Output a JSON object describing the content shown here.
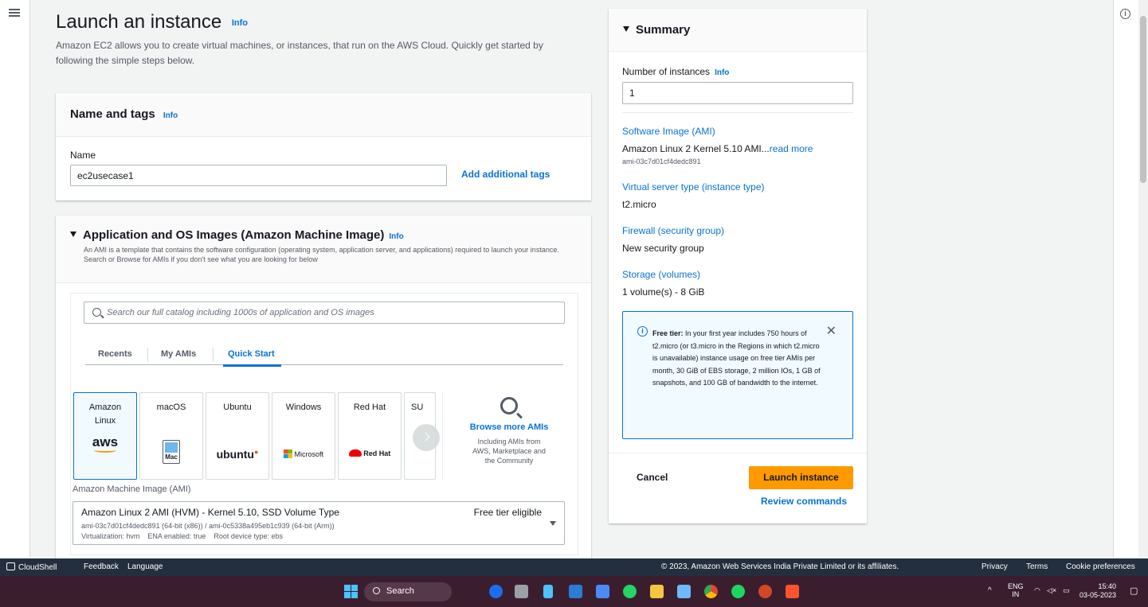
{
  "header": {
    "title": "Launch an instance",
    "info": "Info",
    "description": "Amazon EC2 allows you to create virtual machines, or instances, that run on the AWS Cloud. Quickly get started by following the simple steps below."
  },
  "name_tags": {
    "title": "Name and tags",
    "info": "Info",
    "name_label": "Name",
    "name_value": "ec2usecase1",
    "add_tags": "Add additional tags"
  },
  "ami": {
    "title": "Application and OS Images (Amazon Machine Image)",
    "info": "Info",
    "description": "An AMI is a template that contains the software configuration (operating system, application server, and applications) required to launch your instance. Search or Browse for AMIs if you don't see what you are looking for below",
    "search_placeholder": "Search our full catalog including 1000s of application and OS images",
    "tabs": [
      "Recents",
      "My AMIs",
      "Quick Start"
    ],
    "tiles": [
      {
        "name": "Amazon Linux",
        "logo": "aws"
      },
      {
        "name": "macOS",
        "logo": "Mac"
      },
      {
        "name": "Ubuntu",
        "logo": "ubuntu"
      },
      {
        "name": "Windows",
        "logo": "Microsoft"
      },
      {
        "name": "Red Hat",
        "logo": "Red Hat"
      },
      {
        "name": "SU",
        "logo": ""
      }
    ],
    "browse_link": "Browse more AMIs",
    "browse_desc": "Including AMIs from AWS, Marketplace and the Community",
    "select_label": "Amazon Machine Image (AMI)",
    "selected_title": "Amazon Linux 2 AMI (HVM) - Kernel 5.10, SSD Volume Type",
    "selected_ids": "ami-03c7d01cf4dedc891 (64-bit (x86)) / ami-0c5338a495eb1c939 (64-bit (Arm))",
    "selected_meta": "Virtualization: hvm    ENA enabled: true    Root device type: ebs",
    "free_tier": "Free tier eligible"
  },
  "summary": {
    "title": "Summary",
    "num_label": "Number of instances",
    "info": "Info",
    "num_value": "1",
    "software_label": "Software Image (AMI)",
    "software_value": "Amazon Linux 2 Kernel 5.10 AMI...",
    "read_more": "read more",
    "software_id": "ami-03c7d01cf4dedc891",
    "type_label": "Virtual server type (instance type)",
    "type_value": "t2.micro",
    "firewall_label": "Firewall (security group)",
    "firewall_value": "New security group",
    "storage_label": "Storage (volumes)",
    "storage_value": "1 volume(s) - 8 GiB",
    "freetier_bold": "Free tier:",
    "freetier_text": " In your first year includes 750 hours of t2.micro (or t3.micro in the Regions in which t2.micro is unavailable) instance usage on free tier AMIs per month, 30 GiB of EBS storage, 2 million IOs, 1 GB of snapshots, and 100 GB of bandwidth to the internet.",
    "cancel": "Cancel",
    "launch": "Launch instance",
    "review": "Review commands"
  },
  "footer": {
    "cloudshell": "CloudShell",
    "feedback": "Feedback",
    "language": "Language",
    "copyright": "© 2023, Amazon Web Services India Private Limited or its affiliates.",
    "privacy": "Privacy",
    "terms": "Terms",
    "cookies": "Cookie preferences"
  },
  "taskbar": {
    "search": "Search",
    "lang": "ENG",
    "region": "IN",
    "time": "15:40",
    "date": "03-05-2023"
  },
  "colors": {
    "accent": "#0972d3",
    "launch": "#ff9900",
    "footer": "#232f3e"
  }
}
